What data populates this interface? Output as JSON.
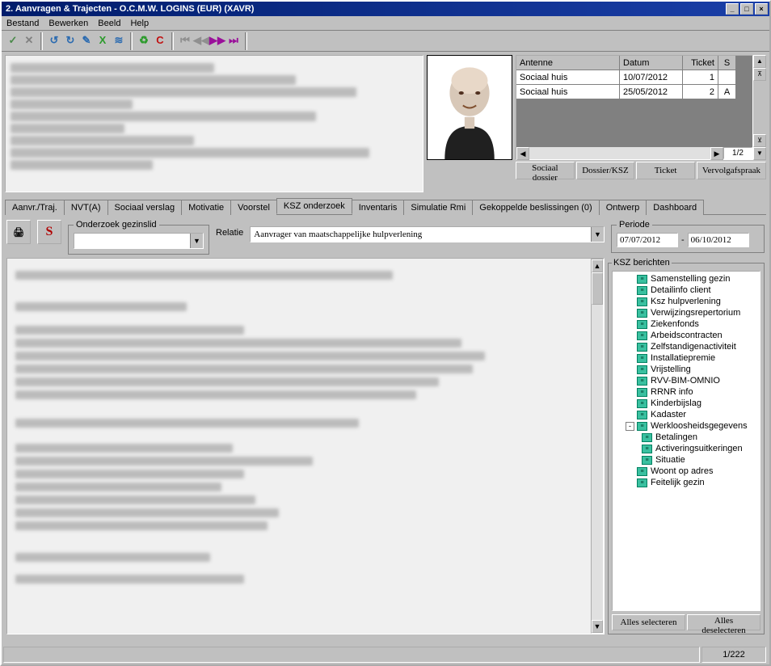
{
  "window": {
    "title": "2. Aanvragen & Trajecten - O.C.M.W. LOGINS (EUR) (XAVR)"
  },
  "menu": {
    "items": [
      "Bestand",
      "Bewerken",
      "Beeld",
      "Help"
    ]
  },
  "grid": {
    "headers": {
      "ant": "Antenne",
      "dat": "Datum",
      "tik": "Ticket",
      "s": "S"
    },
    "rows": [
      {
        "ant": "Sociaal huis",
        "dat": "10/07/2012",
        "tik": "1",
        "s": ""
      },
      {
        "ant": "Sociaal huis",
        "dat": "25/05/2012",
        "tik": "2",
        "s": "A"
      }
    ],
    "page": "1/2"
  },
  "buttons": {
    "sociaal_dossier": "Sociaal dossier",
    "dossier_ksz": "Dossier/KSZ",
    "ticket": "Ticket",
    "vervolg": "Vervolgafspraak"
  },
  "tabs": [
    "Aanvr./Traj.",
    "NVT(A)",
    "Sociaal verslag",
    "Motivatie",
    "Voorstel",
    "KSZ onderzoek",
    "Inventaris",
    "Simulatie Rmi",
    "Gekoppelde beslissingen (0)",
    "Ontwerp",
    "Dashboard"
  ],
  "active_tab_index": 5,
  "ksz": {
    "s_button": "S",
    "onderzoek_label": "Onderzoek gezinslid",
    "onderzoek_value": "",
    "relatie_label": "Relatie",
    "relatie_value": "Aanvrager van maatschappelijke hulpverlening"
  },
  "periode": {
    "label": "Periode",
    "from": "07/07/2012",
    "sep": "-",
    "to": "06/10/2012"
  },
  "tree": {
    "title": "KSZ berichten",
    "items": [
      {
        "label": "Samenstelling gezin",
        "level": 1
      },
      {
        "label": "Detailinfo client",
        "level": 1
      },
      {
        "label": "Ksz hulpverlening",
        "level": 1
      },
      {
        "label": "Verwijzingsrepertorium",
        "level": 1
      },
      {
        "label": "Ziekenfonds",
        "level": 1
      },
      {
        "label": "Arbeidscontracten",
        "level": 1
      },
      {
        "label": "Zelfstandigenactiviteit",
        "level": 1
      },
      {
        "label": "Installatiepremie",
        "level": 1
      },
      {
        "label": "Vrijstelling",
        "level": 1
      },
      {
        "label": "RVV-BIM-OMNIO",
        "level": 1
      },
      {
        "label": "RRNR info",
        "level": 1
      },
      {
        "label": "Kinderbijslag",
        "level": 1
      },
      {
        "label": "Kadaster",
        "level": 1
      },
      {
        "label": "Werkloosheidsgegevens",
        "level": 1,
        "exp": "-"
      },
      {
        "label": "Betalingen",
        "level": 2
      },
      {
        "label": "Activeringsuitkeringen",
        "level": 2
      },
      {
        "label": "Situatie",
        "level": 2
      },
      {
        "label": "Woont op adres",
        "level": 1
      },
      {
        "label": "Feitelijk gezin",
        "level": 1
      }
    ],
    "select_all": "Alles selecteren",
    "deselect_all": "Alles deselecteren"
  },
  "statusbar": {
    "page": "1/222"
  }
}
